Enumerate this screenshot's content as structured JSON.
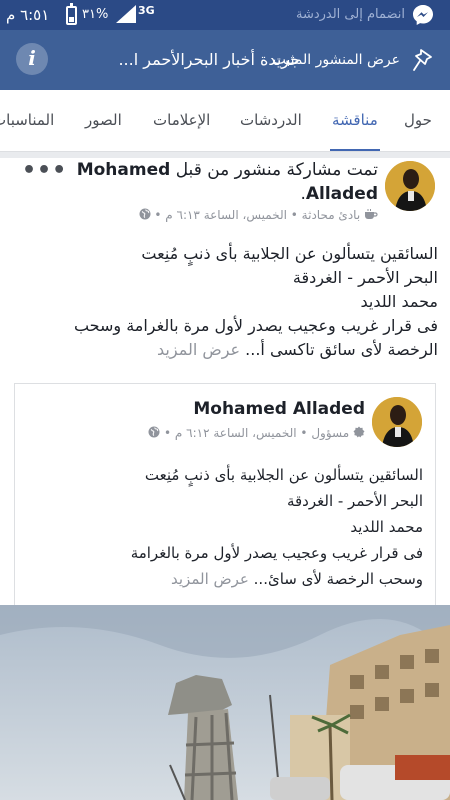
{
  "status_bar": {
    "time": "٦:٥١ م",
    "battery_percent": "٣١%",
    "battery_level": 0.31,
    "network": "3G",
    "notification_text": "انضمام إلى الدردشة"
  },
  "group_header": {
    "back_title": "جريدة أخبار البحرالأحمر ا...",
    "overlay_label": "عرض المنشور المثبت",
    "icons": {
      "info": "info-icon",
      "pin": "pin-icon"
    }
  },
  "tabs": [
    {
      "label": "حول",
      "active": false
    },
    {
      "label": "مناقشة",
      "active": true
    },
    {
      "label": "الدردشات",
      "active": false
    },
    {
      "label": "الإعلامات",
      "active": false
    },
    {
      "label": "الصور",
      "active": false
    },
    {
      "label": "المناسبات",
      "active": false
    }
  ],
  "post": {
    "title_prefix": "تمت مشاركة منشور من قبل",
    "author": "Mohamed Alladed",
    "title_suffix": ".",
    "meta": {
      "role": "بادئ محادثة",
      "day": "الخميس",
      "time": "الساعة ٦:١٣ م",
      "separator": "•"
    },
    "menu_label": "•••",
    "body_lines": [
      "السائقين يتسألون عن الجلابية بأى ذنبٍ مُنِعت",
      "البحر الأحمر - الغردقة",
      "محمد اللديد",
      "فى قرار غريب وعجيب يصدر لأول مرة بالغرامة وسحب",
      "الرخصة لأى سائق تاكسى أ..."
    ],
    "see_more": "عرض المزيد"
  },
  "shared_post": {
    "author": "Mohamed Alladed",
    "meta": {
      "role": "مسؤول",
      "day": "الخميس",
      "time": "الساعة ٦:١٢ م",
      "separator": "•"
    },
    "body_lines": [
      "السائقين يتسألون عن الجلابية بأى ذنبٍ مُنِعت",
      "البحر الأحمر - الغردقة",
      "محمد اللديد",
      "فى قرار غريب وعجيب يصدر لأول مرة بالغرامة",
      "وسحب الرخصة لأى سائ..."
    ],
    "see_more": "عرض المزيد"
  },
  "colors": {
    "status_bar": "#2b4a86",
    "header": "#3e6097",
    "accent": "#4267b2",
    "text": "#1d2129",
    "muted": "#90949c"
  }
}
